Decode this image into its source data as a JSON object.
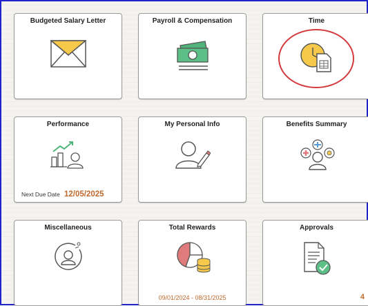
{
  "tiles": {
    "budgeted_salary_letter": {
      "title": "Budgeted Salary Letter",
      "icon": "envelope-icon"
    },
    "payroll_compensation": {
      "title": "Payroll & Compensation",
      "icon": "money-icon"
    },
    "time": {
      "title": "Time",
      "icon": "clock-timesheet-icon"
    },
    "performance": {
      "title": "Performance",
      "icon": "performance-chart-icon",
      "due_label": "Next Due Date",
      "due_value": "12/05/2025"
    },
    "my_personal_info": {
      "title": "My Personal Info",
      "icon": "person-edit-icon"
    },
    "benefits_summary": {
      "title": "Benefits Summary",
      "icon": "benefits-people-icon"
    },
    "miscellaneous": {
      "title": "Miscellaneous",
      "icon": "person-circle-icon"
    },
    "total_rewards": {
      "title": "Total Rewards",
      "icon": "pie-coins-icon",
      "range": "09/01/2024 - 08/31/2025"
    },
    "approvals": {
      "title": "Approvals",
      "icon": "document-check-icon",
      "count": "4"
    }
  },
  "colors": {
    "accent_orange": "#c0692c",
    "highlight_red": "#d2383c",
    "frame_blue": "#1f23c9"
  }
}
